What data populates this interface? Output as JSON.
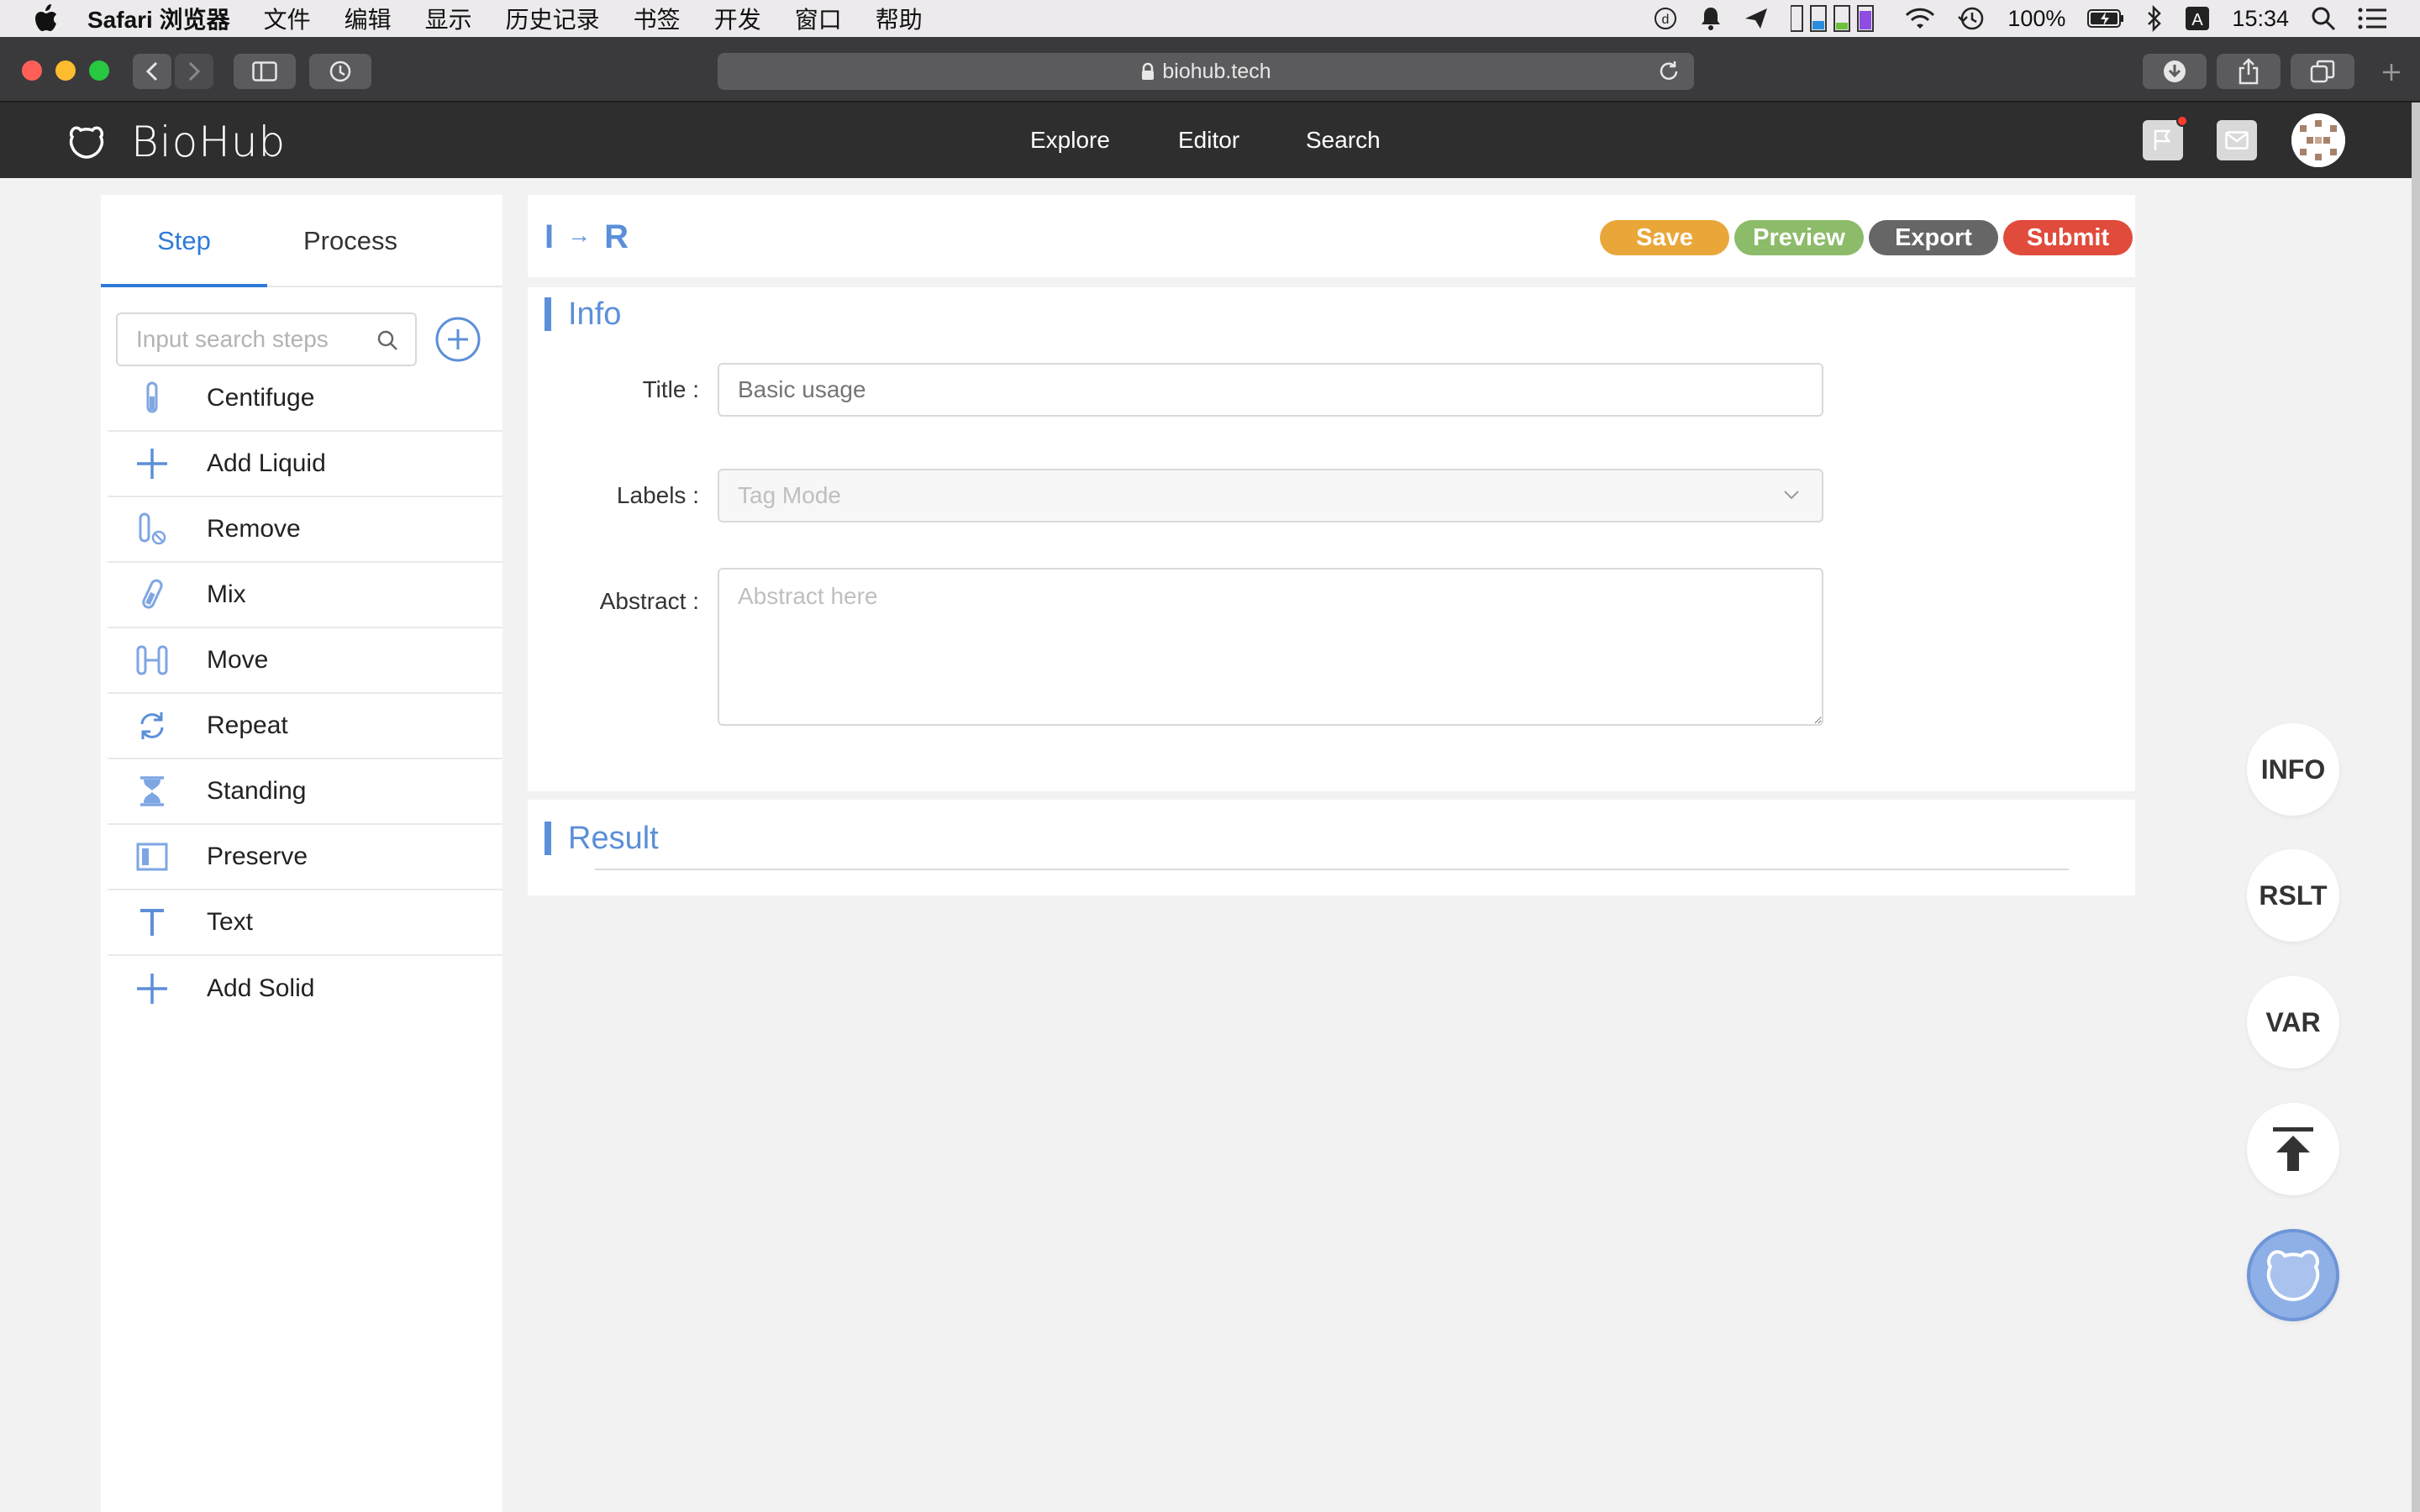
{
  "menubar": {
    "app_name": "Safari 浏览器",
    "items": [
      "文件",
      "编辑",
      "显示",
      "历史记录",
      "书签",
      "开发",
      "窗口",
      "帮助"
    ],
    "battery": "100%",
    "time": "15:34",
    "input_source": "A"
  },
  "browser": {
    "url": "biohub.tech"
  },
  "site": {
    "brand": "BioHub",
    "nav": [
      "Explore",
      "Editor",
      "Search"
    ]
  },
  "sidebar": {
    "tabs": [
      "Step",
      "Process"
    ],
    "active_tab": "Step",
    "search_placeholder": "Input search steps",
    "steps": [
      {
        "label": "Centifuge",
        "icon": "test-tube-icon"
      },
      {
        "label": "Add Liquid",
        "icon": "plus-icon"
      },
      {
        "label": "Remove",
        "icon": "tube-remove-icon"
      },
      {
        "label": "Mix",
        "icon": "mix-tube-icon"
      },
      {
        "label": "Move",
        "icon": "move-tubes-icon"
      },
      {
        "label": "Repeat",
        "icon": "repeat-icon"
      },
      {
        "label": "Standing",
        "icon": "hourglass-icon"
      },
      {
        "label": "Preserve",
        "icon": "fridge-icon"
      },
      {
        "label": "Text",
        "icon": "text-icon"
      },
      {
        "label": "Add Solid",
        "icon": "plus-icon"
      }
    ]
  },
  "editor": {
    "flow_from": "I",
    "flow_arrow": "→",
    "flow_to": "R",
    "buttons": {
      "save": "Save",
      "preview": "Preview",
      "export": "Export",
      "submit": "Submit"
    },
    "info": {
      "heading": "Info",
      "title_label": "Title :",
      "title_placeholder": "Basic usage",
      "labels_label": "Labels :",
      "labels_placeholder": "Tag Mode",
      "abstract_label": "Abstract :",
      "abstract_placeholder": "Abstract here"
    },
    "result": {
      "heading": "Result"
    }
  },
  "float_buttons": [
    "INFO",
    "RSLT",
    "VAR"
  ],
  "colors": {
    "accent": "#5b8fd9",
    "tab_active": "#2f7bd8",
    "save": "#e9a73a",
    "preview": "#8cbb6a",
    "export": "#666666",
    "submit": "#e04b3c"
  }
}
